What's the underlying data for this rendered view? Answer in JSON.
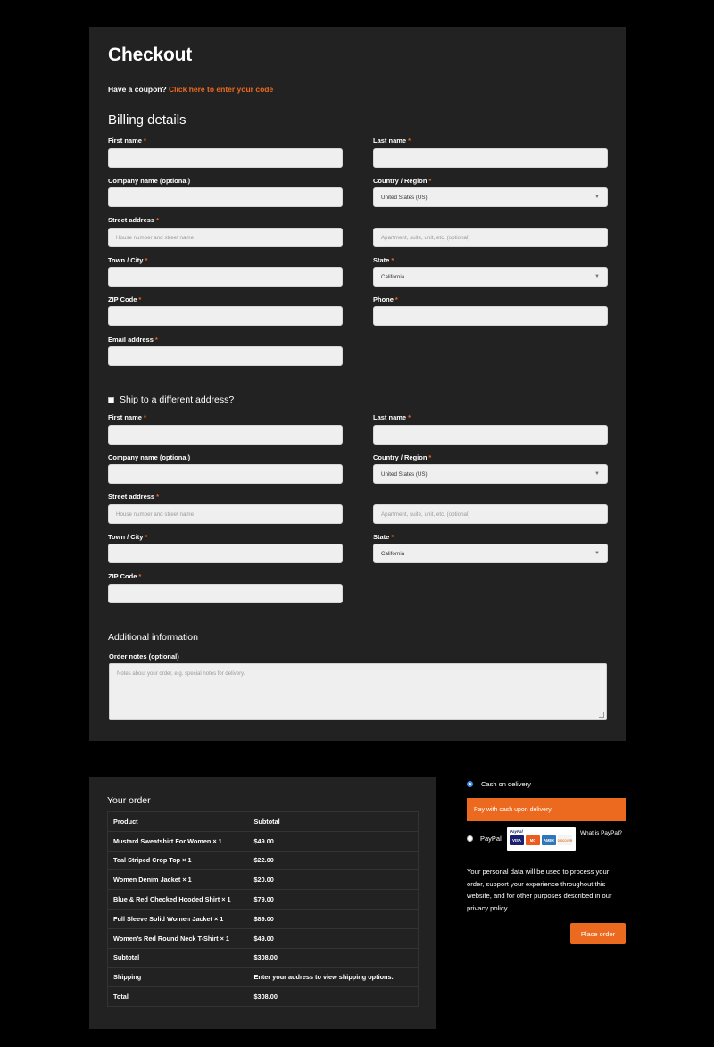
{
  "page": {
    "title": "Checkout"
  },
  "coupon": {
    "prefix": "Have a coupon?",
    "link": "Click here to enter your code"
  },
  "billing": {
    "heading": "Billing details",
    "first_name": "First name",
    "last_name": "Last name",
    "company": "Company name (optional)",
    "country": "Country / Region",
    "country_value": "United States (US)",
    "street": "Street address",
    "street_placeholder": "House number and street name",
    "apt_placeholder": "Apartment, suite, unit, etc. (optional)",
    "city": "Town / City",
    "state": "State",
    "state_value": "California",
    "zip": "ZIP Code",
    "phone": "Phone",
    "email": "Email address",
    "required_mark": "*"
  },
  "shipping": {
    "toggle_label": "Ship to a different address?",
    "first_name": "First name",
    "last_name": "Last name",
    "company": "Company name (optional)",
    "country": "Country / Region",
    "country_value": "United States (US)",
    "street": "Street address",
    "street_placeholder": "House number and street name",
    "apt_placeholder": "Apartment, suite, unit, etc. (optional)",
    "city": "Town / City",
    "state": "State",
    "state_value": "California",
    "zip": "ZIP Code"
  },
  "additional": {
    "heading": "Additional information",
    "notes_label": "Order notes (optional)",
    "notes_placeholder": "Notes about your order, e.g. special notes for delivery."
  },
  "order": {
    "heading": "Your order",
    "col_product": "Product",
    "col_subtotal": "Subtotal",
    "items": [
      {
        "name": "Mustard Sweatshirt For Women",
        "qty": "× 1",
        "price": "$49.00"
      },
      {
        "name": "Teal Striped Crop Top",
        "qty": "× 1",
        "price": "$22.00"
      },
      {
        "name": "Women Denim Jacket",
        "qty": "× 1",
        "price": "$20.00"
      },
      {
        "name": "Blue & Red Checked Hooded Shirt",
        "qty": "× 1",
        "price": "$79.00"
      },
      {
        "name": "Full Sleeve Solid Women Jacket",
        "qty": "× 1",
        "price": "$89.00"
      },
      {
        "name": "Women’s Red Round Neck T-Shirt",
        "qty": "× 1",
        "price": "$49.00"
      }
    ],
    "subtotal_label": "Subtotal",
    "subtotal_value": "$308.00",
    "shipping_label": "Shipping",
    "shipping_value": "Enter your address to view shipping options.",
    "total_label": "Total",
    "total_value": "$308.00"
  },
  "payment": {
    "cod_label": "Cash on delivery",
    "cod_description": "Pay with cash upon delivery.",
    "paypal_label": "PayPal",
    "paypal_logo_text": "PayPal",
    "cards": [
      "VISA",
      "MC",
      "AMEX",
      "DISCOVER"
    ],
    "what_is_paypal": "What is PayPal?",
    "privacy_text": "Your personal data will be used to process your order, support your experience throughout this website, and for other purposes described in our privacy policy.",
    "place_order": "Place order"
  },
  "colors": {
    "accent": "#ec6a1f",
    "panel": "#222222",
    "background": "#000000",
    "radio_selected": "#3b8ef2"
  }
}
